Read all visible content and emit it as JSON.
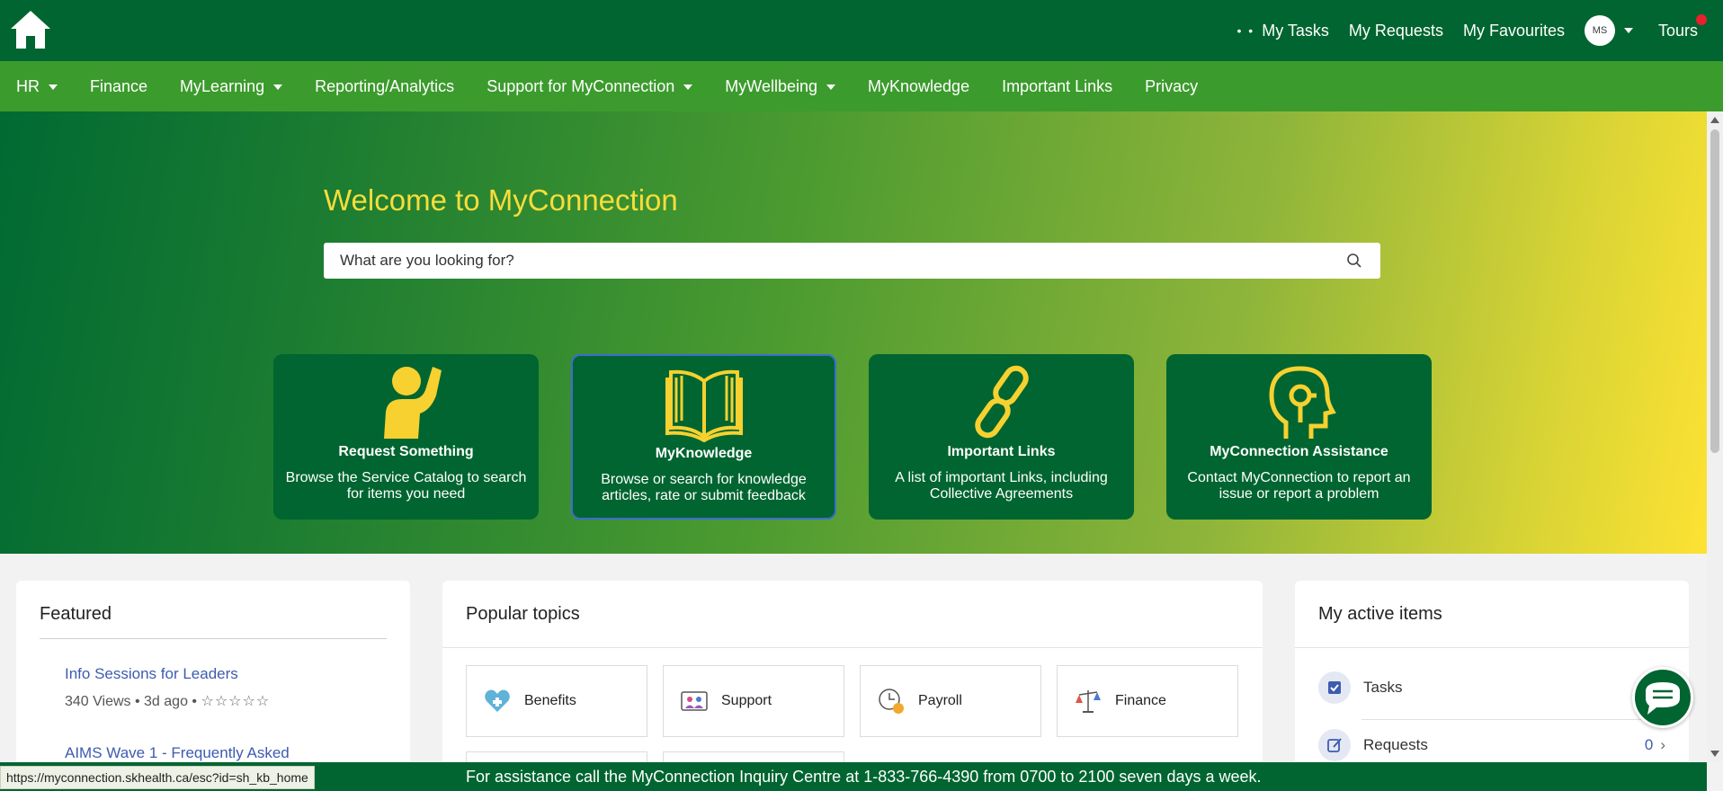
{
  "header": {
    "home_icon": "home-icon",
    "links": [
      "My Tasks",
      "My Requests",
      "My Favourites"
    ],
    "avatar_initials": "MS",
    "tours_label": "Tours"
  },
  "nav": {
    "items": [
      {
        "label": "HR",
        "dropdown": true
      },
      {
        "label": "Finance",
        "dropdown": false
      },
      {
        "label": "MyLearning",
        "dropdown": true
      },
      {
        "label": "Reporting/Analytics",
        "dropdown": false
      },
      {
        "label": "Support for MyConnection",
        "dropdown": true
      },
      {
        "label": "MyWellbeing",
        "dropdown": true
      },
      {
        "label": "MyKnowledge",
        "dropdown": false
      },
      {
        "label": "Important Links",
        "dropdown": false
      },
      {
        "label": "Privacy",
        "dropdown": false
      }
    ]
  },
  "hero": {
    "title": "Welcome to MyConnection",
    "search_placeholder": "What are you looking for?",
    "cards": [
      {
        "title": "Request Something",
        "desc": "Browse the Service Catalog to search for items you need",
        "icon": "waving-person-icon"
      },
      {
        "title": "MyKnowledge",
        "desc": "Browse or search for knowledge articles, rate or submit feedback",
        "icon": "open-book-icon"
      },
      {
        "title": "Important Links",
        "desc": "A list of important Links, including Collective Agreements",
        "icon": "chain-link-icon"
      },
      {
        "title": "MyConnection Assistance",
        "desc": "Contact MyConnection to report an issue or report a problem",
        "icon": "head-gear-icon"
      }
    ]
  },
  "featured": {
    "title": "Featured",
    "items": [
      {
        "title": "Info Sessions for Leaders",
        "views": "340 Views",
        "age": "3d ago",
        "stars": "☆☆☆☆☆"
      },
      {
        "title": "AIMS Wave 1 - Frequently Asked"
      }
    ]
  },
  "popular": {
    "title": "Popular topics",
    "topics": [
      {
        "label": "Benefits",
        "icon": "heart-plus-icon"
      },
      {
        "label": "Support",
        "icon": "support-people-icon"
      },
      {
        "label": "Payroll",
        "icon": "clock-dollar-icon"
      },
      {
        "label": "Finance",
        "icon": "scales-icon"
      }
    ]
  },
  "active_items": {
    "title": "My active items",
    "rows": [
      {
        "label": "Tasks",
        "icon": "checkbox-icon",
        "count": ""
      },
      {
        "label": "Requests",
        "icon": "edit-icon",
        "count": "0"
      }
    ]
  },
  "banner": "For assistance call the MyConnection Inquiry Centre at 1-833-766-4390 from 0700 to 2100 seven days a week.",
  "status_url": "https://myconnection.skhealth.ca/esc?id=sh_kb_home",
  "colors": {
    "header_green": "#006530",
    "nav_green": "#3c9b2d",
    "title_yellow": "#f8dd3a",
    "link_blue": "#3d5bb0"
  }
}
